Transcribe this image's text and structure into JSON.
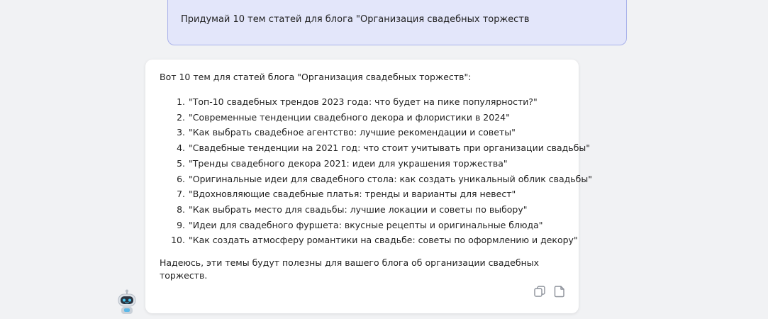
{
  "conversation": {
    "user_message": "Придумай 10 тем статей для блога \"Организация свадебных торжеств",
    "assistant": {
      "intro": "Вот 10 тем для статей блога \"Организация свадебных торжеств\":",
      "topics": [
        {
          "num": "1.",
          "text": "\"Топ-10 свадебных трендов 2023 года: что будет на пике популярности?\""
        },
        {
          "num": "2.",
          "text": "\"Современные тенденции свадебного декора и флористики в 2024\""
        },
        {
          "num": "3.",
          "text": "\"Как выбрать свадебное агентство: лучшие рекомендации и советы\""
        },
        {
          "num": "4.",
          "text": "\"Свадебные тенденции на 2021 год: что стоит учитывать при организации свадьбы\""
        },
        {
          "num": "5.",
          "text": "\"Тренды свадебного декора 2021: идеи для украшения торжества\""
        },
        {
          "num": "6.",
          "text": "\"Оригинальные идеи для свадебного стола: как создать уникальный облик свадьбы\""
        },
        {
          "num": "7.",
          "text": "\"Вдохновляющие свадебные платья: тренды и варианты для невест\""
        },
        {
          "num": "8.",
          "text": "\"Как выбрать место для свадьбы: лучшие локации и советы по выбору\""
        },
        {
          "num": "9.",
          "text": "\"Идеи для свадебного фуршета: вкусные рецепты и оригинальные блюда\""
        },
        {
          "num": "10.",
          "text": "\"Как создать атмосферу романтики на свадьбе: советы по оформлению и декору\""
        }
      ],
      "closing": "Надеюсь, эти темы будут полезны для вашего блога об организации свадебных торжеств."
    }
  },
  "icons": {
    "copy": "copy-icon",
    "save": "document-icon",
    "avatar": "robot-avatar-icon"
  },
  "colors": {
    "background": "#f1f2f4",
    "user_bubble": "#e3e6fa",
    "user_bubble_border": "#a9b2ea",
    "assistant_bubble": "#ffffff",
    "icon": "#8a8f98"
  }
}
